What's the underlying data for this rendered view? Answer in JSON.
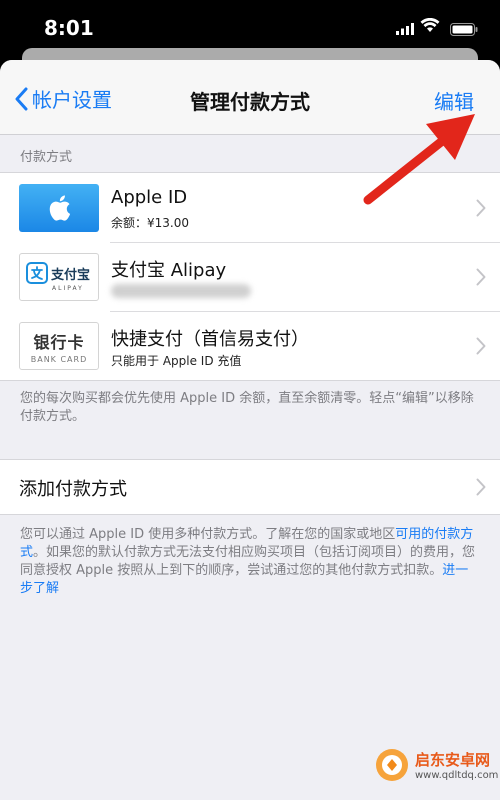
{
  "status_bar": {
    "time": "8:01"
  },
  "nav": {
    "back_label": "帐户设置",
    "title": "管理付款方式",
    "edit_label": "编辑"
  },
  "section_header": "付款方式",
  "payment_methods": [
    {
      "title": "Apple ID",
      "subtitle": "余额：¥13.00",
      "icon": "apple-logo"
    },
    {
      "title": "支付宝 Alipay",
      "thumb_name": "支付宝",
      "thumb_en": "ALIPAY",
      "icon": "alipay-logo"
    },
    {
      "title": "快捷支付（首信易支付）",
      "subtitle": "只能用于 Apple ID 充值",
      "thumb_name": "银行卡",
      "thumb_en": "BANK CARD"
    }
  ],
  "footnote1": "您的每次购买都会优先使用 Apple ID 余额，直至余额清零。轻点“编辑”以移除付款方式。",
  "add_method_label": "添加付款方式",
  "footnote2": {
    "part1": "您可以通过 Apple ID 使用多种付款方式。了解在您的国家或地区",
    "link1": "可用的付款方式",
    "part2": "。如果您的默认付款方式无法支付相应购买项目（包括订阅项目）的费用，您同意授权 Apple 按照从上到下的顺序，尝试通过您的其他付款方式扣款。",
    "link2": "进一步了解"
  },
  "watermark": {
    "name": "启东安卓网",
    "url": "www.qdltdq.com"
  },
  "colors": {
    "accent": "#1a7cf4",
    "annotation_arrow": "#e2261b",
    "background": "#efeff4"
  }
}
